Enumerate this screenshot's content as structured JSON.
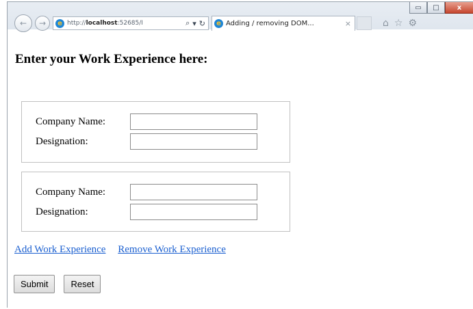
{
  "window": {
    "controls": {
      "minimize_glyph": "▭",
      "maximize_glyph": "□",
      "close_glyph": "x"
    }
  },
  "browser": {
    "address": {
      "protocol": "http://",
      "host": "localhost",
      "rest": ":52685/I"
    },
    "search_icon_glyph": "⌕",
    "dropdown_glyph": "▾",
    "refresh_glyph": "↻",
    "tab": {
      "title": "Adding / removing DOM...",
      "close_glyph": "×"
    },
    "toolbar_icons": {
      "home": "⌂",
      "favorites": "☆",
      "tools": "⚙"
    },
    "back_glyph": "←",
    "forward_glyph": "→",
    "favicon_glyph": "e"
  },
  "page": {
    "heading": "Enter your Work Experience here:",
    "experiences": [
      {
        "company_label": "Company Name:",
        "company_value": "",
        "designation_label": "Designation:",
        "designation_value": ""
      },
      {
        "company_label": "Company Name:",
        "company_value": "",
        "designation_label": "Designation:",
        "designation_value": ""
      }
    ],
    "links": {
      "add": "Add Work Experience",
      "remove": "Remove Work Experience"
    },
    "buttons": {
      "submit": "Submit",
      "reset": "Reset"
    }
  }
}
